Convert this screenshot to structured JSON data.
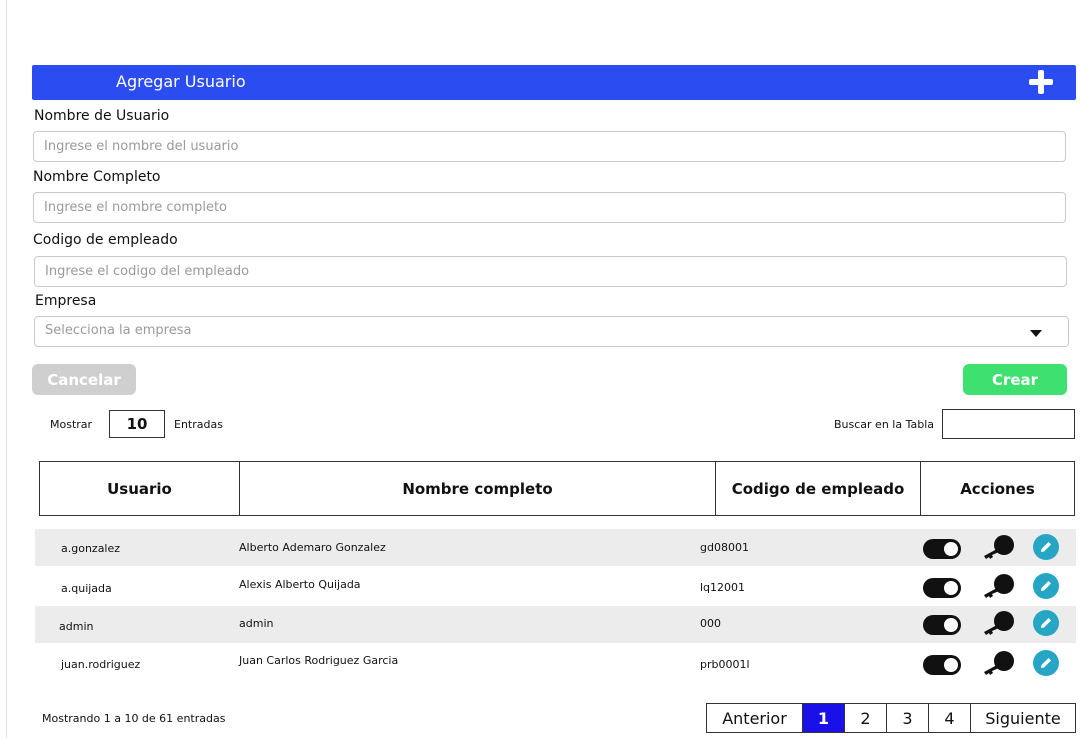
{
  "header": {
    "title": "Agregar Usuario",
    "add_icon": "plus-icon"
  },
  "form": {
    "username": {
      "label": "Nombre de Usuario",
      "placeholder": "Ingrese el nombre del usuario"
    },
    "fullname": {
      "label": "Nombre Completo",
      "placeholder": "Ingrese el nombre completo"
    },
    "employee_code": {
      "label": "Codigo de empleado",
      "placeholder": "Ingrese el codigo del empleado"
    },
    "company": {
      "label": "Empresa",
      "placeholder": "Selecciona la empresa"
    },
    "cancel_label": "Cancelar",
    "create_label": "Crear"
  },
  "table_controls": {
    "show_label": "Mostrar",
    "entries_value": "10",
    "entries_label": "Entradas",
    "search_label": "Buscar en la Tabla"
  },
  "table": {
    "headers": [
      "Usuario",
      "Nombre completo",
      "Codigo de empleado",
      "Acciones"
    ],
    "rows": [
      {
        "usuario": "a.gonzalez",
        "nombre": "Alberto Ademaro Gonzalez",
        "codigo": "gd08001",
        "active": true
      },
      {
        "usuario": "a.quijada",
        "nombre": "Alexis Alberto Quijada",
        "codigo": "lq12001",
        "active": true
      },
      {
        "usuario": "admin",
        "nombre": "admin",
        "codigo": "000",
        "active": true
      },
      {
        "usuario": "juan.rodriguez",
        "nombre": "Juan Carlos Rodriguez Garcia",
        "codigo": "prb0001l",
        "active": true
      }
    ],
    "action_icons": [
      "toggle-icon",
      "key-icon",
      "edit-icon"
    ]
  },
  "footer": {
    "summary": "Mostrando 1 a 10 de 61 entradas",
    "pagination": {
      "prev": "Anterior",
      "pages": [
        "1",
        "2",
        "3",
        "4"
      ],
      "current": "1",
      "next": "Siguiente"
    }
  },
  "colors": {
    "header": "#2b4cf0",
    "create": "#3ee070",
    "cancel": "#cfcfcf",
    "edit": "#26a5c4",
    "active_page": "#1a10e8"
  }
}
